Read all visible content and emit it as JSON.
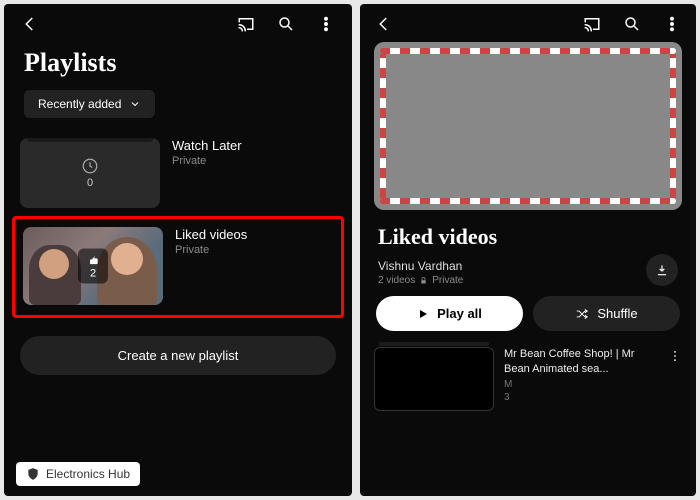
{
  "screen1": {
    "title": "Playlists",
    "sort_label": "Recently added",
    "playlists": [
      {
        "title": "Watch Later",
        "subtitle": "Private",
        "count": "0",
        "kind": "clock"
      },
      {
        "title": "Liked videos",
        "subtitle": "Private",
        "count": "2",
        "kind": "liked"
      }
    ],
    "create_label": "Create a new playlist"
  },
  "screen2": {
    "title": "Liked videos",
    "owner": "Vishnu Vardhan",
    "video_count": "2 videos",
    "privacy": "Private",
    "play_label": "Play all",
    "shuffle_label": "Shuffle",
    "videos": [
      {
        "title": "Mr Bean Coffee Shop! | Mr Bean Animated sea...",
        "channel": "M",
        "views": "3"
      }
    ]
  },
  "watermark": "Electronics Hub"
}
